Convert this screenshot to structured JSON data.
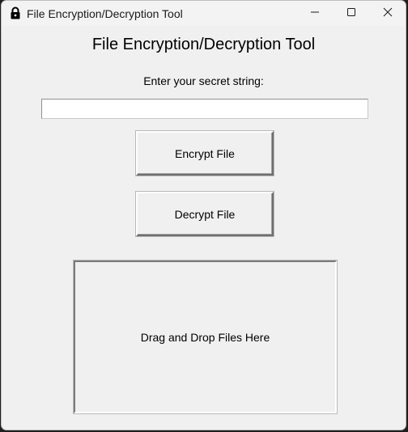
{
  "window": {
    "title": "File Encryption/Decryption Tool",
    "title_icon": "lock-icon",
    "controls": {
      "minimize_icon": "minimize-icon",
      "maximize_icon": "maximize-icon",
      "close_icon": "close-icon"
    }
  },
  "main": {
    "heading": "File Encryption/Decryption Tool",
    "prompt": "Enter your secret string:",
    "secret_input": {
      "value": "",
      "placeholder": ""
    },
    "encrypt_button": "Encrypt File",
    "decrypt_button": "Decrypt File",
    "dropzone_label": "Drag and Drop Files Here"
  },
  "colors": {
    "window_background": "#f0f0f0",
    "input_background": "#ffffff",
    "text": "#000000"
  }
}
